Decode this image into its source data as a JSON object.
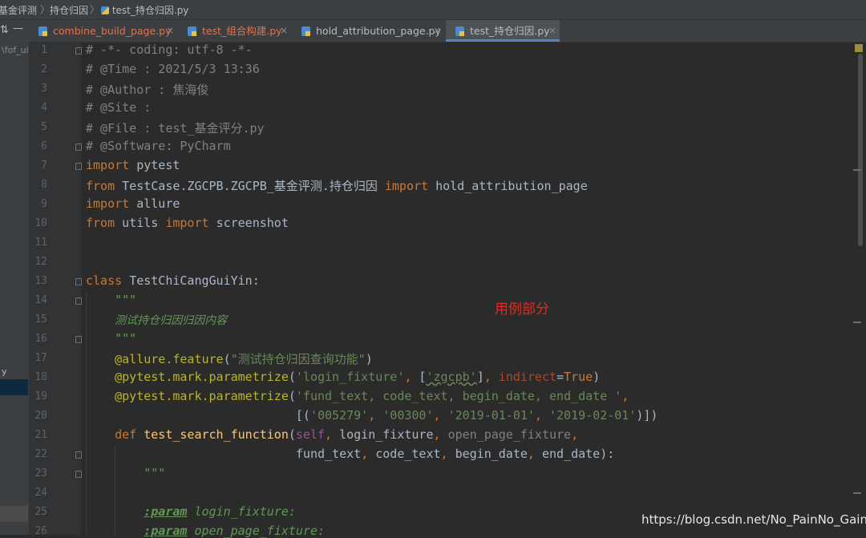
{
  "breadcrumb": {
    "items": [
      "基金评测",
      "持仓归因",
      "test_持仓归因.py"
    ]
  },
  "tabs": [
    {
      "label": "combine_build_page.py",
      "color": "#e0724f"
    },
    {
      "label": "test_组合构建.py",
      "color": "#e0724f"
    },
    {
      "label": "hold_attribution_page.py",
      "color": "#bbbbbb"
    },
    {
      "label": "test_持仓归因.py",
      "color": "#bbbbbb"
    }
  ],
  "sidebar": {
    "dash_label": "—",
    "project_label": "\\fof_ui",
    "item_y": "y"
  },
  "line_numbers": [
    "1",
    "2",
    "3",
    "4",
    "5",
    "6",
    "7",
    "8",
    "9",
    "10",
    "11",
    "12",
    "13",
    "14",
    "15",
    "16",
    "17",
    "18",
    "19",
    "20",
    "21",
    "22",
    "23",
    "24",
    "25",
    "26"
  ],
  "code": {
    "l1": "# -*- coding: utf-8 -*-",
    "l2": "# @Time : 2021/5/3 13:36",
    "l3": "# @Author : 焦海俊",
    "l4": "# @Site : ",
    "l5": "# @File : test_基金评分.py",
    "l6": "# @Software: PyCharm",
    "kw_import": "import",
    "kw_from": "from",
    "kw_class": "class",
    "kw_def": "def",
    "mod_pytest": "pytest",
    "mod_testcase": "TestCase.ZGCPB.ZGCPB_基金评测.持仓归因",
    "mod_hold": "hold_attribution_page",
    "mod_allure": "allure",
    "mod_utils": "utils",
    "mod_screenshot": "screenshot",
    "class_name": "TestChiCangGuiYin:",
    "doc_quote": "\"\"\"",
    "doc_text": "测试持仓归因归因内容",
    "dec1_name": "@allure.feature",
    "dec1_arg": "\"测试持仓归因查询功能\"",
    "dec2_name": "@pytest.mark.parametrize",
    "dec2_a": "'login_fixture'",
    "dec2_b": "'zgcpb'",
    "dec2_kw": "indirect",
    "dec2_true": "True",
    "dec3_a": "'fund_text, code_text, begin_date, end_date '",
    "dec3_v1": "'005279'",
    "dec3_v2": "'00300'",
    "dec3_v3": "'2019-01-01'",
    "dec3_v4": "'2019-02-01'",
    "fn_name": "test_search_function",
    "p_self": "self",
    "p_login": "login_fixture",
    "p_open": "open_page_fixture",
    "p_fund": "fund_text",
    "p_code": "code_text",
    "p_begin": "begin_date",
    "p_end": "end_date",
    "tag_param": ":param",
    "d_login": " login_fixture:",
    "d_open": " open_page_fixture:"
  },
  "annotation": "用例部分",
  "watermark": "https://blog.csdn.net/No_PainNo_Gain",
  "colors": {
    "keyword": "#cc7832",
    "string": "#6a8759",
    "comment": "#808080",
    "annotation": "#e8291f"
  }
}
